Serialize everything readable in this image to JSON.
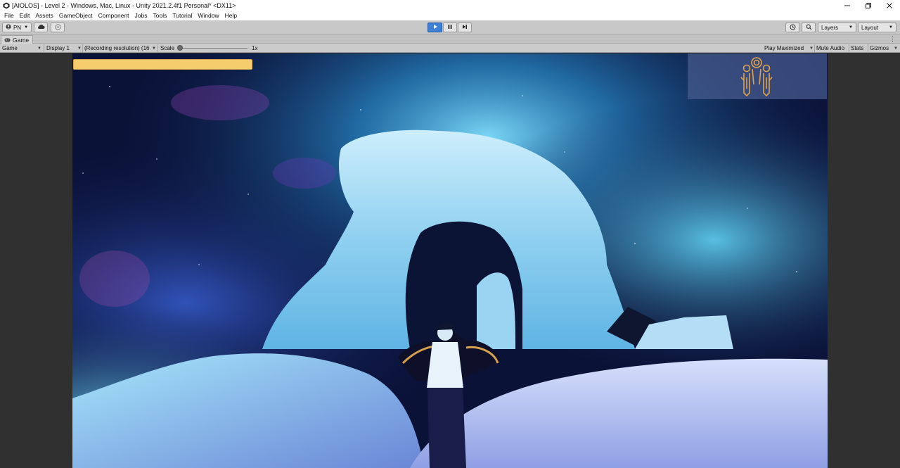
{
  "window": {
    "title": "[AIOLOS] - Level 2 - Windows, Mac, Linux - Unity 2021.2.4f1 Personal* <DX11>",
    "icon": "unity-logo-icon",
    "controls": [
      "minimize-icon",
      "restore-icon",
      "close-icon"
    ]
  },
  "menu": {
    "items": [
      "File",
      "Edit",
      "Assets",
      "GameObject",
      "Component",
      "Jobs",
      "Tools",
      "Tutorial",
      "Window",
      "Help"
    ]
  },
  "toolbar": {
    "account_label": "PN",
    "cloud_icon": "cloud-icon",
    "collab_icon": "collab-icon",
    "play_icon": "play-icon",
    "pause_icon": "pause-icon",
    "step_icon": "step-icon",
    "history_icon": "history-icon",
    "search_icon": "search-icon",
    "layers_label": "Layers",
    "layout_label": "Layout",
    "play_active_color": "#3d7fd6"
  },
  "tab": {
    "label": "Game",
    "icon": "gamepad-icon"
  },
  "game_bar": {
    "view_mode": "Game",
    "display": "Display 1",
    "resolution": "(Recording resolution) (16",
    "scale_label": "Scale",
    "scale_value": "1x",
    "scale_fraction": 0.0,
    "play_maximized": "Play Maximized",
    "mute_audio": "Mute Audio",
    "stats": "Stats",
    "gizmos": "Gizmos"
  },
  "hud": {
    "health_color": "#f6cd6d",
    "health_fraction": 1.0,
    "minimap_icon": "twin-spirits-emblem-icon"
  },
  "scene": {
    "description_colors": {
      "sky_dark": "#0a1440",
      "nebula_cyan": "#3fb3e6",
      "ice": "#a9dcf4",
      "snow": "#b9c6f0"
    }
  }
}
